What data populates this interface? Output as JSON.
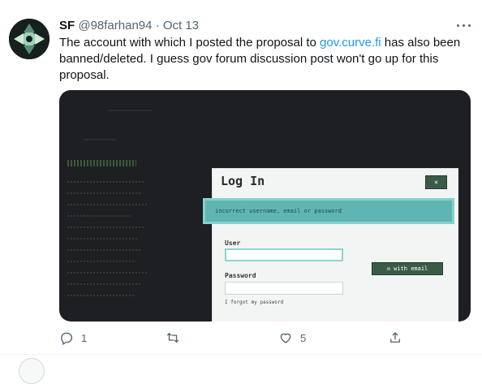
{
  "tweet": {
    "display_name": "SF",
    "handle": "@98farhan94",
    "separator": "·",
    "date": "Oct 13",
    "text_before_link": "The account with which I posted the proposal to ",
    "link_text": "gov.curve.fi",
    "text_after_link": " has also been banned/deleted. I guess gov forum discussion post won't go up for this proposal.",
    "more_icon": "more-horizontal-icon"
  },
  "screenshot": {
    "title": "Log In",
    "close_label": "×",
    "error_message": "incorrect username, email or password",
    "user_label": "User",
    "user_value": "",
    "password_label": "Password",
    "password_value": "",
    "email_button_label": "✉ with email",
    "forgot_label": "I forgot my password"
  },
  "actions": {
    "reply_count": "1",
    "retweet_count": "",
    "like_count": "5",
    "share_icon": "share-icon"
  },
  "colors": {
    "link": "#1d9bf0",
    "muted": "#536471",
    "banner": "#5fb5b2",
    "button": "#3a5c47"
  }
}
